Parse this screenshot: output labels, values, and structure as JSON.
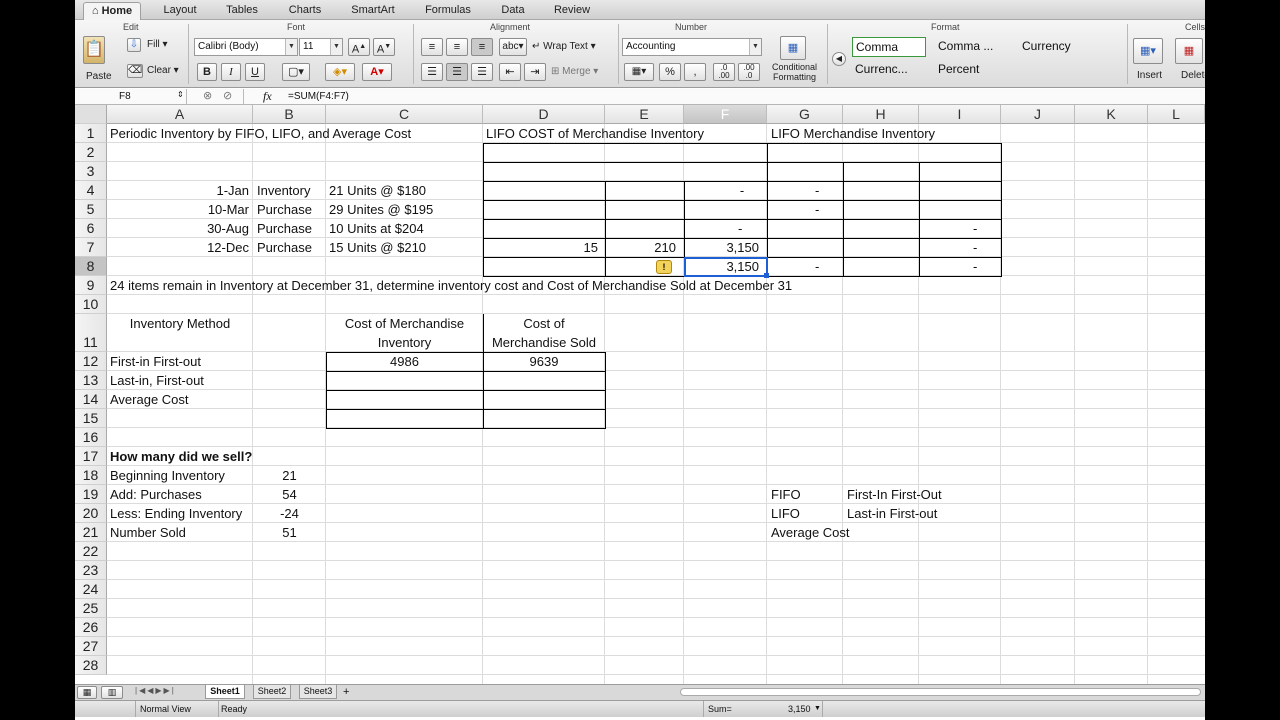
{
  "ribbon": {
    "tabs": [
      "Home",
      "Layout",
      "Tables",
      "Charts",
      "SmartArt",
      "Formulas",
      "Data",
      "Review"
    ],
    "groups": {
      "edit": "Edit",
      "font": "Font",
      "alignment": "Alignment",
      "number": "Number",
      "format": "Format",
      "cells": "Cells"
    },
    "paste": "Paste",
    "fill": "Fill",
    "clear": "Clear",
    "font_name": "Calibri (Body)",
    "font_size": "11",
    "wrap_text": "Wrap Text",
    "merge": "Merge",
    "number_format": "Accounting",
    "conditional_formatting": [
      "Conditional",
      "Formatting"
    ],
    "styles": [
      "Comma",
      "Comma ...",
      "Currency",
      "Currenc...",
      "Percent"
    ],
    "insert": "Insert",
    "delete": "Delete"
  },
  "formula_bar": {
    "cell_ref": "F8",
    "fx": "fx",
    "formula": "=SUM(F4:F7)"
  },
  "columns": [
    "A",
    "B",
    "C",
    "D",
    "E",
    "F",
    "G",
    "H",
    "I",
    "J",
    "K",
    "L"
  ],
  "rows": [
    "1",
    "2",
    "3",
    "4",
    "5",
    "6",
    "7",
    "8",
    "9",
    "10",
    "11",
    "12",
    "13",
    "14",
    "15",
    "16",
    "17",
    "18",
    "19",
    "20",
    "21",
    "22",
    "23",
    "24",
    "25",
    "26",
    "27",
    "28"
  ],
  "cells": {
    "A1": "Periodic Inventory by FIFO, LIFO, and Average Cost",
    "D1": "LIFO COST of Merchandise Inventory",
    "G1": "LIFO Merchandise Inventory",
    "A4": "1-Jan",
    "B4": "Inventory",
    "C4": "21 Units @ $180",
    "F4": "-",
    "G4": "-",
    "A5": "10-Mar",
    "B5": "Purchase",
    "C5": "29 Unites @ $195",
    "G5": "-",
    "A6": "30-Aug",
    "B6": "Purchase",
    "C6": "10 Units at $204",
    "F6": "-",
    "I6": "-",
    "A7": "12-Dec",
    "B7": "Purchase",
    "C7": "15 Units @ $210",
    "D7": "15",
    "E7": "210",
    "F7": "3,150",
    "I7": "-",
    "F8": "3,150",
    "G8": "-",
    "I8": "-",
    "A9": "24 items remain in Inventory at December 31, determine inventory cost and Cost of Merchandise Sold at December 31",
    "A11": "Inventory Method",
    "C11a": "Cost of Merchandise",
    "C11b": "Inventory",
    "D11a": "Cost of",
    "D11b": "Merchandise Sold",
    "A12": "First-in First-out",
    "C12": "4986",
    "D12": "9639",
    "A13": "Last-in, First-out",
    "A14": "Average Cost",
    "A17": "How many did we sell?",
    "A18": "Beginning Inventory",
    "B18": "21",
    "A19": "Add:  Purchases",
    "B19": "54",
    "A20": "Less: Ending Inventory",
    "B20": "-24",
    "A21": "Number Sold",
    "B21": "51",
    "G19": "FIFO",
    "H19": "First-In First-Out",
    "G20": "LIFO",
    "H20": "Last-in First-out",
    "G21": "Average Cost"
  },
  "sheets": [
    "Sheet1",
    "Sheet2",
    "Sheet3"
  ],
  "status": {
    "view": "Normal View",
    "state": "Ready",
    "sum_label": "Sum=",
    "sum_value": "3,150"
  }
}
